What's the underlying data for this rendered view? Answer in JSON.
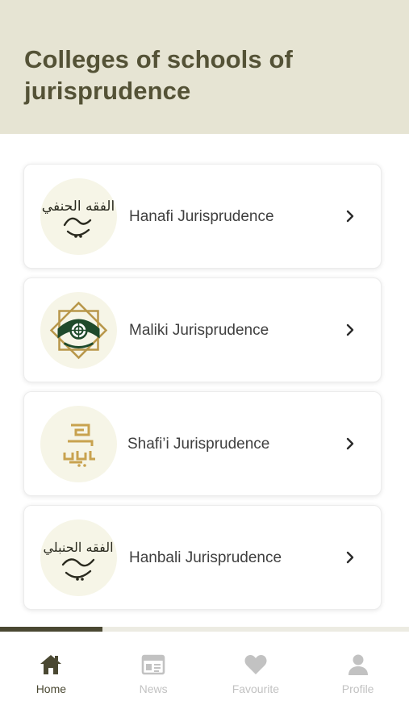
{
  "header": {
    "title_line1": "Colleges of schools of",
    "title_line2": "jurisprudence"
  },
  "colors": {
    "header_bg": "#e6e4d3",
    "title_text": "#545236",
    "accent": "#4a4832",
    "inactive_nav": "#c2c2c2",
    "logo_bg": "#f6f5e7"
  },
  "schools": [
    {
      "label": "Hanafi Jurisprudence",
      "logo_text": "الفقه الحنفي",
      "logo_icon": "hanafi-calligraphy-logo"
    },
    {
      "label": "Maliki Jurisprudence",
      "logo_icon": "maliki-star-emblem-logo"
    },
    {
      "label": "Shafi’i Jurisprudence",
      "logo_icon": "shafii-kufic-logo"
    },
    {
      "label": "Hanbali Jurisprudence",
      "logo_text": "الفقه الحنبلي",
      "logo_icon": "hanbali-calligraphy-logo"
    }
  ],
  "progress": {
    "fraction": 0.25
  },
  "nav": [
    {
      "label": "Home",
      "icon": "home-icon",
      "active": true
    },
    {
      "label": "News",
      "icon": "news-icon",
      "active": false
    },
    {
      "label": "Favourite",
      "icon": "heart-icon",
      "active": false
    },
    {
      "label": "Profile",
      "icon": "profile-icon",
      "active": false
    }
  ]
}
